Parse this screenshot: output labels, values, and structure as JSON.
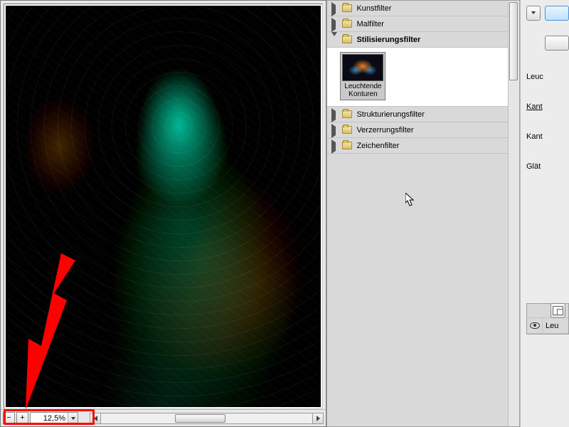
{
  "preview": {
    "zoom_value": "12,5%"
  },
  "filter_tree": {
    "categories": [
      {
        "label": "Kunstfilter",
        "expanded": false,
        "selected": false
      },
      {
        "label": "Malfilter",
        "expanded": false,
        "selected": false
      },
      {
        "label": "Stilisierungsfilter",
        "expanded": true,
        "selected": true
      },
      {
        "label": "Strukturierungsfilter",
        "expanded": false,
        "selected": false
      },
      {
        "label": "Verzerrungsfilter",
        "expanded": false,
        "selected": false
      },
      {
        "label": "Zeichenfilter",
        "expanded": false,
        "selected": false
      }
    ],
    "stil_thumbs": [
      {
        "label": "Leuchtende Konturen",
        "selected": true
      }
    ]
  },
  "params": {
    "filter_name": "Leuc",
    "p1_label": "Kant",
    "p2_label": "Kant",
    "p3_label": "Glät"
  },
  "effects": {
    "row0": "Leu"
  },
  "icons": {
    "zoom_out": "−",
    "zoom_in": "+"
  }
}
